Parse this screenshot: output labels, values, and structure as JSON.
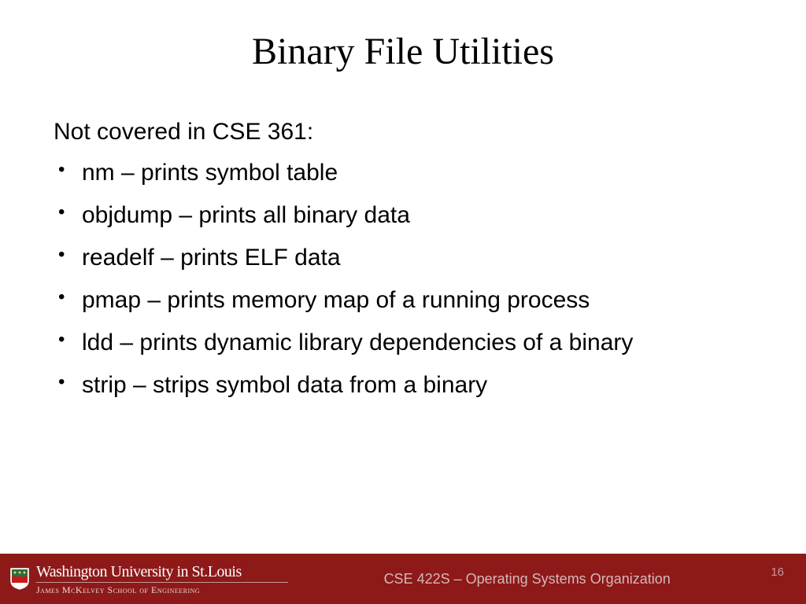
{
  "title": "Binary File Utilities",
  "intro": "Not covered in CSE 361:",
  "bullets": [
    "nm – prints symbol table",
    "objdump – prints all binary data",
    "readelf – prints ELF data",
    "pmap – prints memory map of a running process",
    "ldd – prints dynamic library dependencies of a binary",
    "strip – strips symbol data from a binary"
  ],
  "footer": {
    "university": "Washington University in St.Louis",
    "school": "James McKelvey School of Engineering",
    "course": "CSE 422S – Operating Systems Organization",
    "page": "16"
  }
}
